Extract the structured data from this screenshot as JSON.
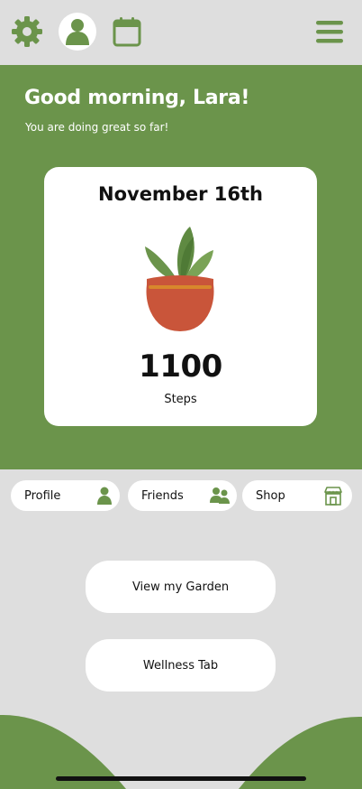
{
  "theme": {
    "accent": "#6b944b",
    "background": "#dedede",
    "card": "#ffffff",
    "pot": "#c9553a",
    "pot_band": "#d8872c"
  },
  "topbar": {
    "icons": [
      "gear-icon",
      "avatar-icon",
      "calendar-icon",
      "hamburger-menu-icon"
    ]
  },
  "header": {
    "greeting": "Good morning, Lara!",
    "subtitle": "You are doing great so far!"
  },
  "card": {
    "date": "November 16th",
    "steps_value": "1100",
    "steps_label": "Steps"
  },
  "nav_pills": [
    {
      "label": "Profile",
      "icon": "person-icon"
    },
    {
      "label": "Friends",
      "icon": "friends-icon"
    },
    {
      "label": "Shop",
      "icon": "store-icon"
    }
  ],
  "actions": {
    "garden_label": "View my Garden",
    "wellness_label": "Wellness Tab"
  }
}
